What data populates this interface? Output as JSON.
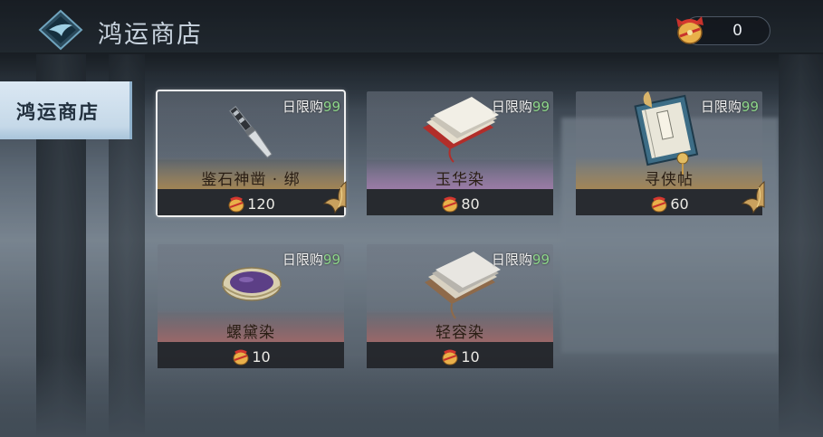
{
  "header": {
    "title": "鸿运商店",
    "currency": {
      "icon": "lucky-bag-icon",
      "amount": "0"
    }
  },
  "sidebar": {
    "tabs": [
      {
        "label": "鸿运商店",
        "selected": true
      }
    ]
  },
  "shop": {
    "items": [
      {
        "name": "鉴石神凿 · 绑",
        "limit_label": "日限购",
        "limit_count": "99",
        "price": "120",
        "rarity": "gold",
        "icon": "chisel-icon",
        "selected": true
      },
      {
        "name": "玉华染",
        "limit_label": "日限购",
        "limit_count": "99",
        "price": "80",
        "rarity": "purple",
        "icon": "dye-cloth-icon",
        "selected": false
      },
      {
        "name": "寻侠帖",
        "limit_label": "日限购",
        "limit_count": "99",
        "price": "60",
        "rarity": "gold",
        "icon": "invitation-book-icon",
        "selected": false
      },
      {
        "name": "螺黛染",
        "limit_label": "日限购",
        "limit_count": "99",
        "price": "10",
        "rarity": "red",
        "icon": "dye-bowl-icon",
        "selected": false
      },
      {
        "name": "轻容染",
        "limit_label": "日限购",
        "limit_count": "99",
        "price": "10",
        "rarity": "red",
        "icon": "dye-cloth-icon",
        "selected": false
      }
    ]
  },
  "colors": {
    "gold_band": "#ab874e",
    "purple_band": "#a07caa",
    "red_band": "#a06868",
    "limit_number": "#8dd68a",
    "tab_bg": "#cfe0ee"
  }
}
